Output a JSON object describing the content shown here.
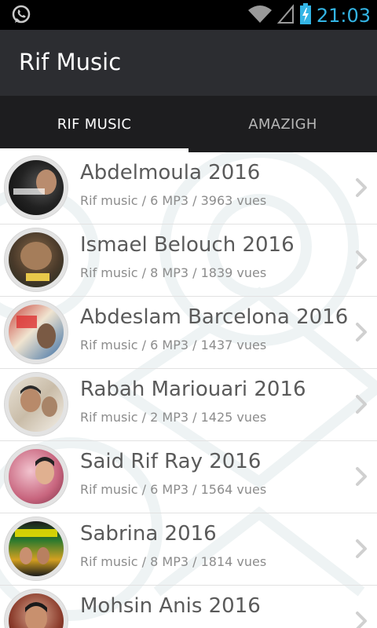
{
  "status_bar": {
    "time": "21:03",
    "icons": [
      "whatsapp-icon",
      "wifi-icon",
      "signal-icon",
      "battery-charging-icon"
    ],
    "accent": "#33b5e5"
  },
  "app": {
    "title": "Rif Music"
  },
  "tabs": [
    {
      "label": "RIF MUSIC",
      "active": true
    },
    {
      "label": "AMAZIGH",
      "active": false
    }
  ],
  "items": [
    {
      "title": "Abdelmoula 2016",
      "subtitle": "Rif music / 6 MP3 / 3963 vues"
    },
    {
      "title": "Ismael Belouch 2016",
      "subtitle": "Rif music / 8 MP3 / 1839 vues"
    },
    {
      "title": "Abdeslam Barcelona 2016",
      "subtitle": "Rif music / 6 MP3 / 1437 vues"
    },
    {
      "title": "Rabah Mariouari 2016",
      "subtitle": "Rif music / 2 MP3 / 1425 vues"
    },
    {
      "title": "Said Rif Ray 2016",
      "subtitle": "Rif music / 6 MP3 / 1564 vues"
    },
    {
      "title": "Sabrina 2016",
      "subtitle": "Rif music / 8 MP3 / 1814 vues"
    },
    {
      "title": "Mohsin Anis 2016",
      "subtitle": ""
    }
  ],
  "colors": {
    "action_bar": "#2c2d31",
    "tab_bar": "#1d1d1f",
    "title_text": "#5a5a5a",
    "subtitle_text": "#8c8c8c"
  }
}
